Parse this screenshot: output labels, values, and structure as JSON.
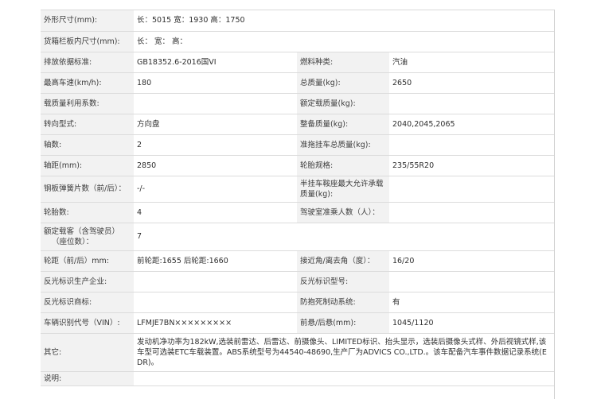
{
  "rows": [
    {
      "l1": "外形尺寸(mm):",
      "v1": "长：5015 宽：1930 高：1750"
    },
    {
      "l1": "货箱栏板内尺寸(mm):",
      "v1": "长：  宽：  高："
    },
    {
      "l1": "排放依据标准:",
      "v1": "GB18352.6-2016国VI",
      "l2": "燃料种类:",
      "v2": "汽油"
    },
    {
      "l1": "最高车速(km/h):",
      "v1": "180",
      "l2": "总质量(kg):",
      "v2": "2650"
    },
    {
      "l1": "载质量利用系数:",
      "v1": "",
      "l2": "额定载质量(kg):",
      "v2": ""
    },
    {
      "l1": "转向型式:",
      "v1": "方向盘",
      "l2": "整备质量(kg):",
      "v2": "2040,2045,2065"
    },
    {
      "l1": "轴数:",
      "v1": "2",
      "l2": "准拖挂车总质量(kg):",
      "v2": ""
    },
    {
      "l1": "轴距(mm):",
      "v1": "2850",
      "l2": "轮胎规格:",
      "v2": "235/55R20"
    },
    {
      "l1": "钢板弹簧片数（前/后）：",
      "v1": "-/-",
      "l2": "半挂车鞍座最大允许承载质量(kg):",
      "v2": ""
    },
    {
      "l1": "轮胎数:",
      "v1": "4",
      "l2": "驾驶室准乘人数（人）：",
      "v2": ""
    },
    {
      "l1a": "额定载客（含驾驶员）",
      "l1b": "（座位数）：",
      "v1": "7"
    },
    {
      "l1": "轮距（前/后）mm:",
      "v1": "前轮距:1655 后轮距:1660",
      "l2": "接近角/离去角（度）：",
      "v2": "16/20"
    },
    {
      "l1": "反光标识生产企业:",
      "v1": "",
      "l2": "反光标识型号:",
      "v2": ""
    },
    {
      "l1": "反光标识商标:",
      "v1": "",
      "l2": "防抱死制动系统:",
      "v2": "有"
    },
    {
      "l1": "车辆识别代号（VIN）:",
      "v1": "LFMJE7BN×××××××××",
      "l2": "前悬/后悬(mm):",
      "v2": "1045/1120"
    },
    {
      "l1": "其它:",
      "v1": "发动机净功率为182kW,选装前雷达、后雷达、前摄像头、LIMITED标识、抬头显示，选装后摄像头式样、外后视镜式样,该车型可选装ETC车载装置。ABS系统型号为44540-48690,生产厂为ADVICS CO.,LTD.。该车配备汽车事件数据记录系统(EDR)。"
    },
    {
      "l1": "说明:",
      "v1": ""
    }
  ]
}
